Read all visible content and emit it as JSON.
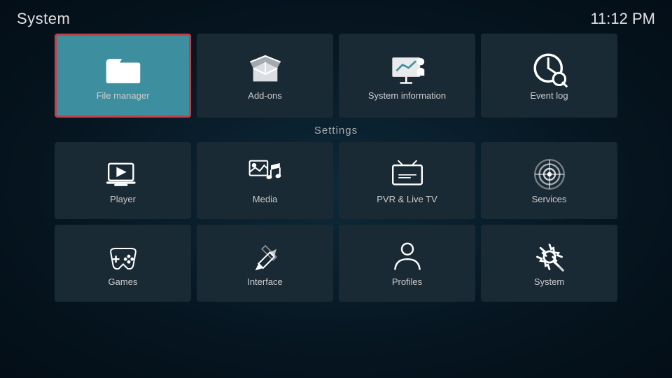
{
  "header": {
    "title": "System",
    "time": "11:12 PM"
  },
  "top_tiles": [
    {
      "id": "file-manager",
      "label": "File manager",
      "selected": true
    },
    {
      "id": "add-ons",
      "label": "Add-ons",
      "selected": false
    },
    {
      "id": "system-information",
      "label": "System information",
      "selected": false
    },
    {
      "id": "event-log",
      "label": "Event log",
      "selected": false
    }
  ],
  "settings_label": "Settings",
  "settings_row1": [
    {
      "id": "player",
      "label": "Player"
    },
    {
      "id": "media",
      "label": "Media"
    },
    {
      "id": "pvr-live-tv",
      "label": "PVR & Live TV"
    },
    {
      "id": "services",
      "label": "Services"
    }
  ],
  "settings_row2": [
    {
      "id": "games",
      "label": "Games"
    },
    {
      "id": "interface",
      "label": "Interface"
    },
    {
      "id": "profiles",
      "label": "Profiles"
    },
    {
      "id": "system",
      "label": "System"
    }
  ]
}
